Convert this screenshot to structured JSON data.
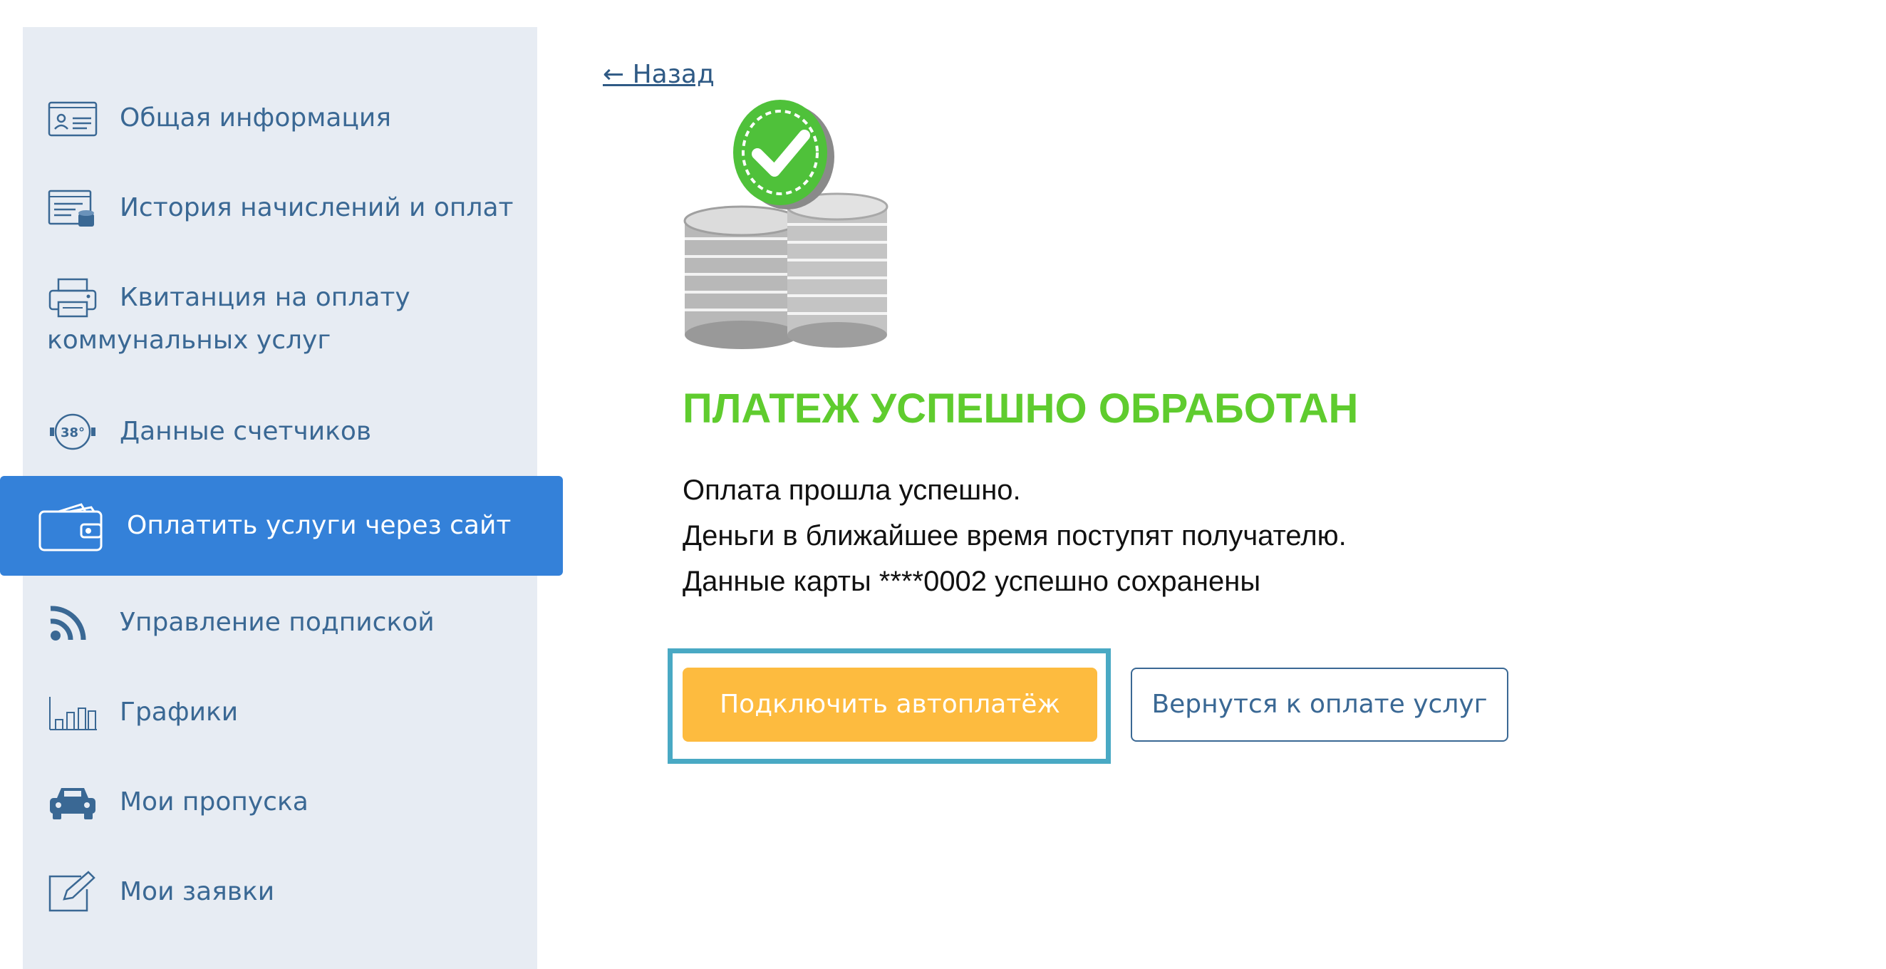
{
  "sidebar": {
    "items": [
      {
        "label": "Общая информация",
        "icon": "id-card-icon"
      },
      {
        "label": "История начислений и оплат",
        "icon": "billing-history-icon"
      },
      {
        "label": "Квитанция на оплату коммунальных услуг",
        "icon": "printer-icon"
      },
      {
        "label": "Данные счетчиков",
        "icon": "meter-icon"
      },
      {
        "label": "Оплатить услуги через сайт",
        "icon": "wallet-icon",
        "active": true
      },
      {
        "label": "Управление подпиской",
        "icon": "rss-icon"
      },
      {
        "label": "Графики",
        "icon": "bar-chart-icon"
      },
      {
        "label": "Мои пропуска",
        "icon": "car-icon"
      },
      {
        "label": "Мои заявки",
        "icon": "edit-icon"
      }
    ],
    "meter_icon_text": "38°"
  },
  "main": {
    "back_link": "← Назад",
    "title": "ПЛАТЕЖ УСПЕШНО ОБРАБОТАН",
    "message_lines": [
      "Оплата прошла успешно.",
      "Деньги в ближайшее время поступят получателю.",
      "Данные карты ****0002 успешно сохранены"
    ],
    "primary_button": "Подключить автоплатёж",
    "secondary_button": "Вернутся к оплате услуг"
  },
  "colors": {
    "sidebar_bg": "#e7ecf3",
    "active_bg": "#3481d9",
    "title_green": "#5fcc2e",
    "primary_button": "#fdbb3f",
    "highlight_border": "#49a9c4",
    "text_blue": "#3a6894"
  }
}
